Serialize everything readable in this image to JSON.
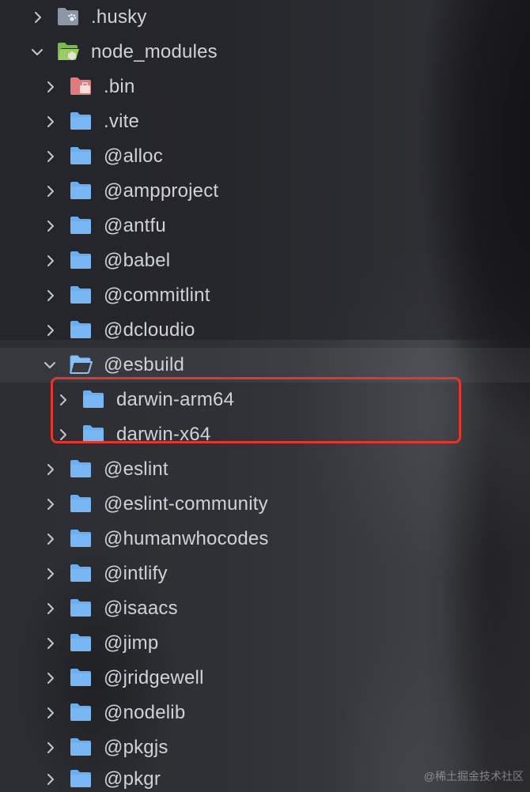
{
  "tree": {
    "items": [
      {
        "label": ".husky",
        "icon": "husky-folder-icon",
        "expanded": false
      },
      {
        "label": "node_modules",
        "icon": "node-modules-folder-open-icon",
        "expanded": true
      },
      {
        "label": ".bin",
        "icon": "bin-folder-icon",
        "expanded": false
      },
      {
        "label": ".vite",
        "icon": "folder-icon",
        "expanded": false
      },
      {
        "label": "@alloc",
        "icon": "folder-icon",
        "expanded": false
      },
      {
        "label": "@ampproject",
        "icon": "folder-icon",
        "expanded": false
      },
      {
        "label": "@antfu",
        "icon": "folder-icon",
        "expanded": false
      },
      {
        "label": "@babel",
        "icon": "folder-icon",
        "expanded": false
      },
      {
        "label": "@commitlint",
        "icon": "folder-icon",
        "expanded": false
      },
      {
        "label": "@dcloudio",
        "icon": "folder-icon",
        "expanded": false
      },
      {
        "label": "@esbuild",
        "icon": "folder-open-icon",
        "expanded": true
      },
      {
        "label": "darwin-arm64",
        "icon": "folder-icon",
        "expanded": false
      },
      {
        "label": "darwin-x64",
        "icon": "folder-icon",
        "expanded": false
      },
      {
        "label": "@eslint",
        "icon": "folder-icon",
        "expanded": false
      },
      {
        "label": "@eslint-community",
        "icon": "folder-icon",
        "expanded": false
      },
      {
        "label": "@humanwhocodes",
        "icon": "folder-icon",
        "expanded": false
      },
      {
        "label": "@intlify",
        "icon": "folder-icon",
        "expanded": false
      },
      {
        "label": "@isaacs",
        "icon": "folder-icon",
        "expanded": false
      },
      {
        "label": "@jimp",
        "icon": "folder-icon",
        "expanded": false
      },
      {
        "label": "@jridgewell",
        "icon": "folder-icon",
        "expanded": false
      },
      {
        "label": "@nodelib",
        "icon": "folder-icon",
        "expanded": false
      },
      {
        "label": "@pkgjs",
        "icon": "folder-icon",
        "expanded": false
      },
      {
        "label": "@pkgr",
        "icon": "folder-icon",
        "expanded": false
      }
    ]
  },
  "colors": {
    "folder": "#6aaef2",
    "highlight": "#e2372c",
    "bin_folder": "#e07b7b",
    "node_modules_folder": "#8bc34a"
  },
  "watermark": "@稀土掘金技术社区"
}
